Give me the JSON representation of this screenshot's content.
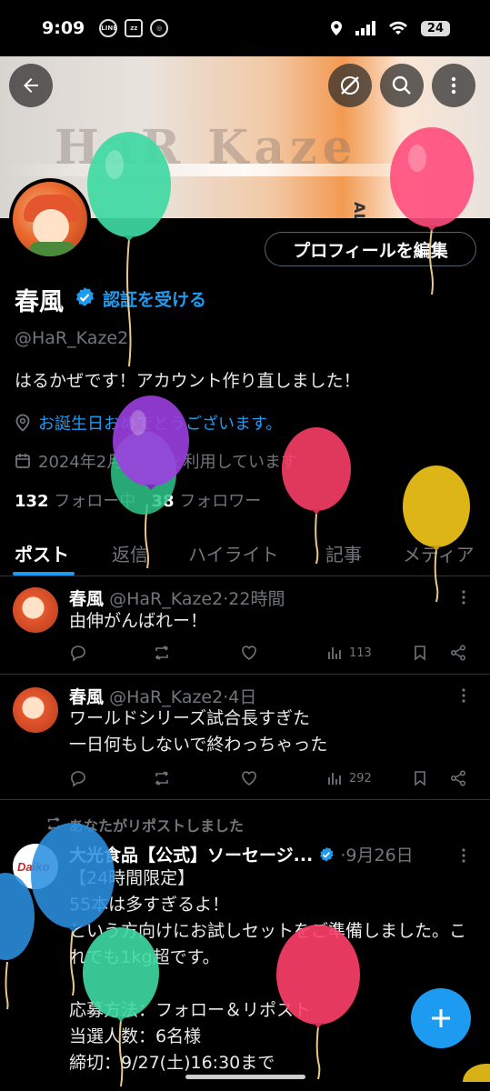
{
  "status_bar": {
    "time": "9:09",
    "icons": [
      "line-icon",
      "zzz-icon",
      "target-icon"
    ],
    "battery": "24"
  },
  "profile": {
    "name": "春風",
    "get_verified": "認証を受ける",
    "handle": "@HaR_Kaze2",
    "bio": "はるかぜです！アカウント作り直しました！",
    "birthday_text": "お誕生日おめでとうございます。",
    "joined_text": "2024年2月からXを利用しています",
    "following_count": "132",
    "following_label": "フォロー中",
    "followers_count": "38",
    "followers_label": "フォロワー",
    "edit_button": "プロフィールを編集",
    "banner_side_text": "ALL Kill"
  },
  "tabs": [
    "ポスト",
    "返信",
    "ハイライト",
    "記事",
    "メディア"
  ],
  "posts": [
    {
      "name": "春風",
      "handle": "@HaR_Kaze2",
      "time": "22時間",
      "text": "由伸がんばれー！",
      "views": "113"
    },
    {
      "name": "春風",
      "handle": "@HaR_Kaze2",
      "time": "4日",
      "text": "ワールドシリーズ試合長すぎた\n一日何もしないで終わっちゃった",
      "views": "292"
    }
  ],
  "repost": {
    "label": "あなたがリポストしました",
    "name": "大光食品【公式】ソーセージ...",
    "time": "9月26日",
    "text": "【24時間限定】\n55本は多すぎるよ！\nという方向けにお試しセットをご準備しました。これでも1kg超です。\n\n応募方法：フォロー＆リポスト\n当選人数：6名様\n締切：9/27(土)16:30まで"
  },
  "colors": {
    "accent": "#1d9bf0",
    "background": "#000000",
    "muted": "#71767b"
  },
  "fab_icon": "plus-icon"
}
